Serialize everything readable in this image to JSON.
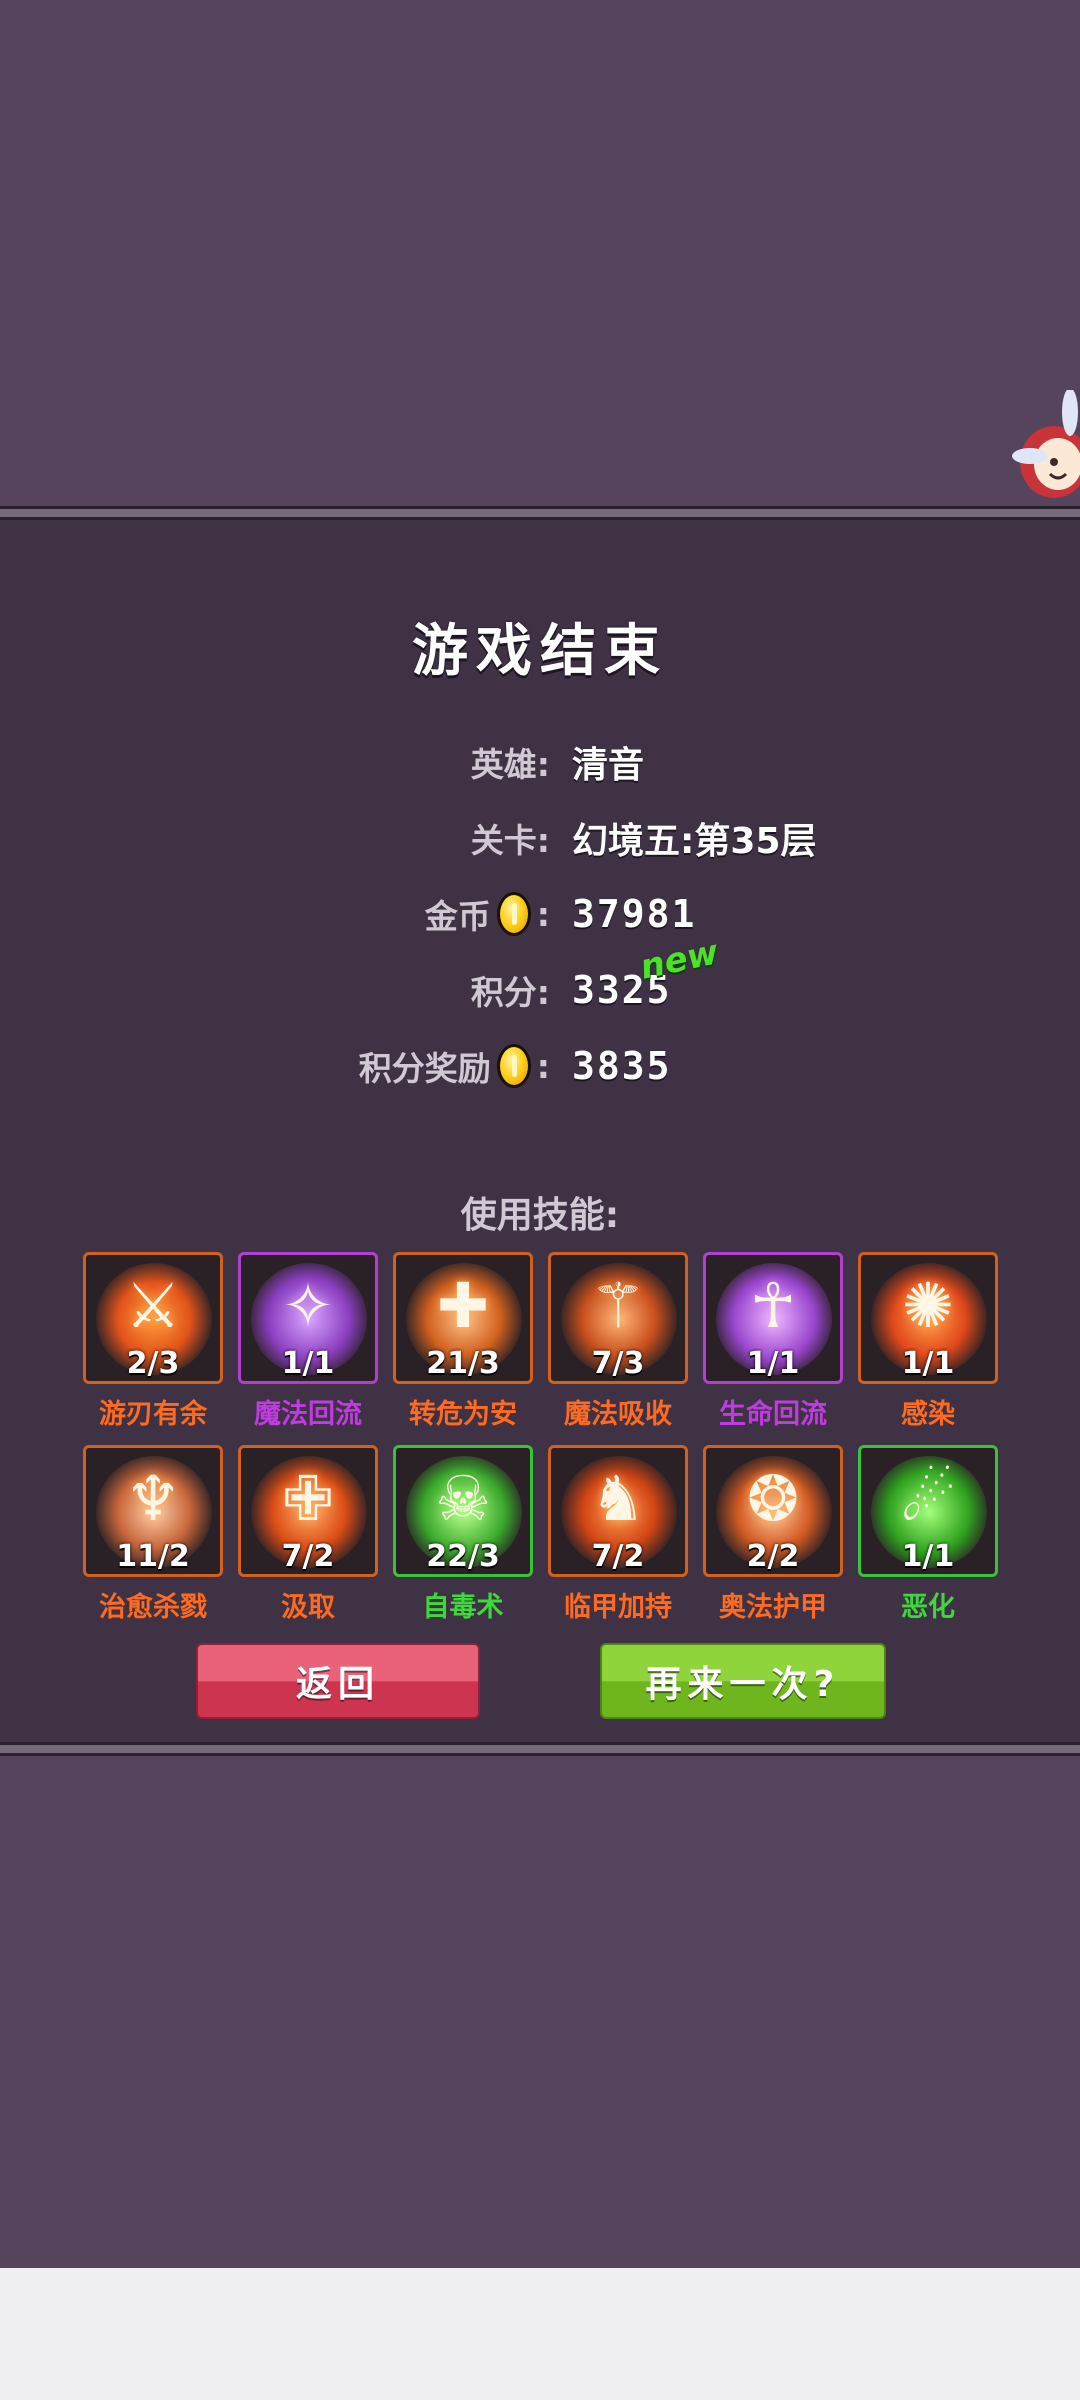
{
  "screen": {
    "title": "游戏结束"
  },
  "stats": {
    "hero_label": "英雄:",
    "hero_value": "清音",
    "level_label": "关卡:",
    "level_value": "幻境五:第35层",
    "gold_label": "金币",
    "gold_colon": ":",
    "gold_value": "37981",
    "score_label": "积分:",
    "score_value": "3325",
    "new_badge": "new",
    "bonus_label": "积分奖励",
    "bonus_colon": ":",
    "bonus_value": "3835"
  },
  "skills_heading": "使用技能:",
  "skills": [
    {
      "name": "游刃有余",
      "count": "2/3",
      "color": "#ff6a1e",
      "rarity": "orange",
      "icon": "sword-swirl-icon"
    },
    {
      "name": "魔法回流",
      "count": "1/1",
      "color": "#c13ae4",
      "rarity": "purple",
      "icon": "magic-flow-icon"
    },
    {
      "name": "转危为安",
      "count": "21/3",
      "color": "#ff6a1e",
      "rarity": "orange",
      "icon": "safety-cross-icon"
    },
    {
      "name": "魔法吸收",
      "count": "7/3",
      "color": "#ff6a1e",
      "rarity": "orange",
      "icon": "caduceus-icon"
    },
    {
      "name": "生命回流",
      "count": "1/1",
      "color": "#c13ae4",
      "rarity": "purple",
      "icon": "life-flow-icon"
    },
    {
      "name": "感染",
      "count": "1/1",
      "color": "#ff6a1e",
      "rarity": "orange",
      "icon": "splatter-icon"
    },
    {
      "name": "治愈杀戮",
      "count": "11/2",
      "color": "#ff6a1e",
      "rarity": "orange",
      "icon": "healing-figure-icon"
    },
    {
      "name": "汲取",
      "count": "7/2",
      "color": "#ff6a1e",
      "rarity": "orange",
      "icon": "drain-cross-icon"
    },
    {
      "name": "自毒术",
      "count": "22/3",
      "color": "#3dd83a",
      "rarity": "green",
      "icon": "poison-skull-icon"
    },
    {
      "name": "临甲加持",
      "count": "7/2",
      "color": "#ff6a1e",
      "rarity": "orange",
      "icon": "running-figure-icon"
    },
    {
      "name": "奥法护甲",
      "count": "2/2",
      "color": "#ff6a1e",
      "rarity": "orange",
      "icon": "arcane-shield-icon"
    },
    {
      "name": "恶化",
      "count": "1/1",
      "color": "#3dd83a",
      "rarity": "green",
      "icon": "dripping-slime-icon"
    }
  ],
  "buttons": {
    "back": "返回",
    "retry": "再来一次?"
  },
  "colors": {
    "background": "#56445d",
    "panel": "#3f3245",
    "back_button": "#e9627a",
    "retry_button": "#8fd43a",
    "skill_orange": "#ff6a1e",
    "skill_purple": "#c13ae4",
    "skill_green": "#3dd83a"
  }
}
